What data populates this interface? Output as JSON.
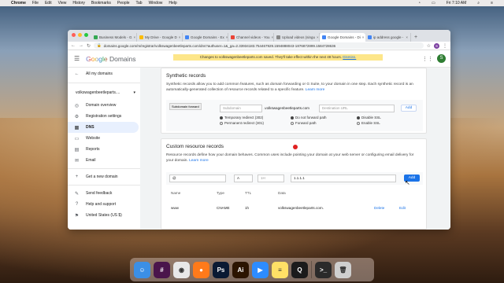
{
  "menubar": {
    "items": [
      "Chrome",
      "File",
      "Edit",
      "View",
      "History",
      "Bookmarks",
      "People",
      "Tab",
      "Window",
      "Help"
    ],
    "clock": "Fri 7:10 AM"
  },
  "tabs": [
    {
      "label": "Business Models - G",
      "color": "#34a853"
    },
    {
      "label": "My Drive - Google D",
      "color": "#fbbc04"
    },
    {
      "label": "Google Domains - Ex",
      "color": "#4285f4"
    },
    {
      "label": "Channel videos - You",
      "color": "#ea4335"
    },
    {
      "label": "Upload videos (singu",
      "color": "#888888"
    },
    {
      "label": "Google Domains - Di",
      "color": "#4285f4"
    },
    {
      "label": "ip address google -",
      "color": "#4285f4"
    }
  ],
  "address": {
    "url": "domains.google.com/m/registrar/volkswagenbeetleparts.com/dns?authuser=1&_ga=2.33934183.754467929.1594888043-1876872899.1584728636",
    "avatar": "S"
  },
  "header": {
    "logo_google": "Google",
    "logo_domains": "Domains",
    "toast_text": "Changes to volkswagenbeetleparts.com saved. They'll take effect within the next 48 hours.",
    "toast_dismiss": "Dismiss.",
    "avatar": "S"
  },
  "sidebar": {
    "back": "All my domains",
    "domain": "volkswagenbeetleparts....",
    "items": [
      {
        "label": "Domain overview",
        "icon": "◎"
      },
      {
        "label": "Registration settings",
        "icon": "⚙"
      },
      {
        "label": "DNS",
        "icon": "▦"
      },
      {
        "label": "Website",
        "icon": "▭"
      },
      {
        "label": "Reports",
        "icon": "▤"
      },
      {
        "label": "Email",
        "icon": "✉"
      }
    ],
    "new_domain": "Get a new domain",
    "feedback": "Send feedback",
    "help": "Help and support",
    "country": "United States (US $)"
  },
  "synthetic": {
    "title": "Synthetic records",
    "desc": "Synthetic records allow you to add common features, such as domain forwarding or G Suite, to your domain in one step. Each synthetic record is an automatically-generated collection of resource records related to a specific feature.",
    "learn_more": "Learn more",
    "type_select": "Subdomain forward",
    "subdomain_placeholder": "Subdomain",
    "domain_suffix": ".volkswagenbeetleparts.com",
    "dest_placeholder": "Destination URL",
    "radios": {
      "temp": "Temporary redirect (302)",
      "perm": "Permanent redirect (301)",
      "no_fwd": "Do not forward path",
      "fwd": "Forward path",
      "dis_ssl": "Disable SSL",
      "en_ssl": "Enable SSL"
    },
    "add": "Add"
  },
  "custom": {
    "title": "Custom resource records",
    "desc": "Resource records define how your domain behaves. Common uses include pointing your domain at your web server or configuring email delivery for your domain.",
    "learn_more": "Learn more",
    "name_value": "@",
    "type_value": "A",
    "ttl_placeholder": "1H",
    "data_value": "1.1.1.1",
    "add": "Add",
    "headers": {
      "name": "Name",
      "type": "Type",
      "ttl": "TTL",
      "data": "Data"
    },
    "rows": [
      {
        "name": "www",
        "type": "CNAME",
        "ttl": "1h",
        "data": "volkswagenbeetleparts.com.",
        "delete": "Delete",
        "edit": "Edit"
      }
    ]
  },
  "dock": [
    {
      "name": "finder",
      "color": "#3b8fe6",
      "glyph": "☺"
    },
    {
      "name": "slack",
      "color": "#4a154b",
      "glyph": "#"
    },
    {
      "name": "chrome",
      "color": "#e8e8e8",
      "glyph": "◉"
    },
    {
      "name": "firefox",
      "color": "#ff7a1a",
      "glyph": "●"
    },
    {
      "name": "photoshop",
      "color": "#0a1a33",
      "glyph": "Ps"
    },
    {
      "name": "illustrator",
      "color": "#2b1400",
      "glyph": "Ai"
    },
    {
      "name": "zoom",
      "color": "#2d8cff",
      "glyph": "▶"
    },
    {
      "name": "notes",
      "color": "#ffe066",
      "glyph": "≡"
    },
    {
      "name": "quicktime",
      "color": "#1b1b1b",
      "glyph": "Q"
    },
    {
      "name": "terminal",
      "color": "#2a2a2a",
      "glyph": ">_"
    },
    {
      "name": "trash",
      "color": "#cfcfcf",
      "glyph": "🗑"
    }
  ]
}
